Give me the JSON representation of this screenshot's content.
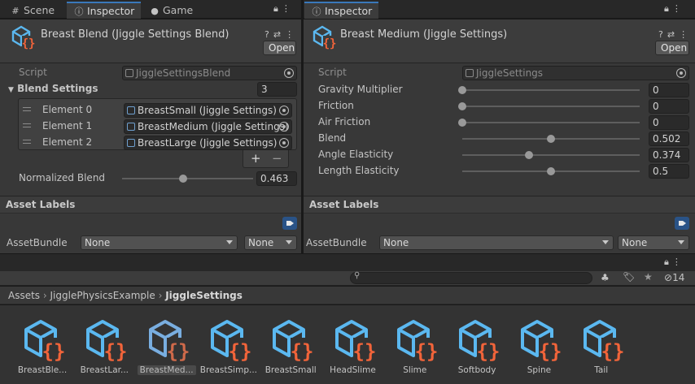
{
  "left_tabs": {
    "scene": "Scene",
    "inspector": "Inspector",
    "game": "Game"
  },
  "right_tabs": {
    "inspector": "Inspector"
  },
  "left_inspector": {
    "title": "Breast Blend (Jiggle Settings Blend)",
    "open_label": "Open",
    "script_label": "Script",
    "script_value": "JiggleSettingsBlend",
    "blend_settings_label": "Blend Settings",
    "blend_settings_count": "3",
    "elements": [
      {
        "label": "Element 0",
        "value": "BreastSmall (Jiggle Settings)"
      },
      {
        "label": "Element 1",
        "value": "BreastMedium (Jiggle Settings)"
      },
      {
        "label": "Element 2",
        "value": "BreastLarge (Jiggle Settings)"
      }
    ],
    "add_label": "+",
    "remove_label": "−",
    "normalized_blend_label": "Normalized Blend",
    "normalized_blend_value": "0.463",
    "asset_labels": "Asset Labels",
    "asset_bundle_label": "AssetBundle",
    "asset_bundle_value": "None",
    "asset_variant_value": "None"
  },
  "right_inspector": {
    "title": "Breast Medium (Jiggle Settings)",
    "open_label": "Open",
    "script_label": "Script",
    "script_value": "JiggleSettings",
    "properties": [
      {
        "label": "Gravity Multiplier",
        "value": "0",
        "fraction": 0.0
      },
      {
        "label": "Friction",
        "value": "0",
        "fraction": 0.0
      },
      {
        "label": "Air Friction",
        "value": "0",
        "fraction": 0.0
      },
      {
        "label": "Blend",
        "value": "0.502",
        "fraction": 0.502
      },
      {
        "label": "Angle Elasticity",
        "value": "0.374",
        "fraction": 0.374
      },
      {
        "label": "Length Elasticity",
        "value": "0.5",
        "fraction": 0.5
      }
    ],
    "asset_labels": "Asset Labels",
    "asset_bundle_label": "AssetBundle",
    "asset_bundle_value": "None",
    "asset_variant_value": "None"
  },
  "project": {
    "hidden_count": "14",
    "breadcrumb": [
      "Assets",
      "JigglePhysicsExample",
      "JiggleSettings"
    ],
    "assets": [
      {
        "label": "BreastBle...",
        "selected": false
      },
      {
        "label": "BreastLar...",
        "selected": false
      },
      {
        "label": "BreastMed...",
        "selected": true
      },
      {
        "label": "BreastSimp...",
        "selected": false
      },
      {
        "label": "BreastSmall",
        "selected": false
      },
      {
        "label": "HeadSlime",
        "selected": false
      },
      {
        "label": "Slime",
        "selected": false
      },
      {
        "label": "Softbody",
        "selected": false
      },
      {
        "label": "Spine",
        "selected": false
      },
      {
        "label": "Tail",
        "selected": false
      }
    ]
  },
  "colors": {
    "accent": "#3a79bb",
    "script_icon_blue": "#5bb8f0",
    "script_icon_orange": "#f2643a"
  }
}
